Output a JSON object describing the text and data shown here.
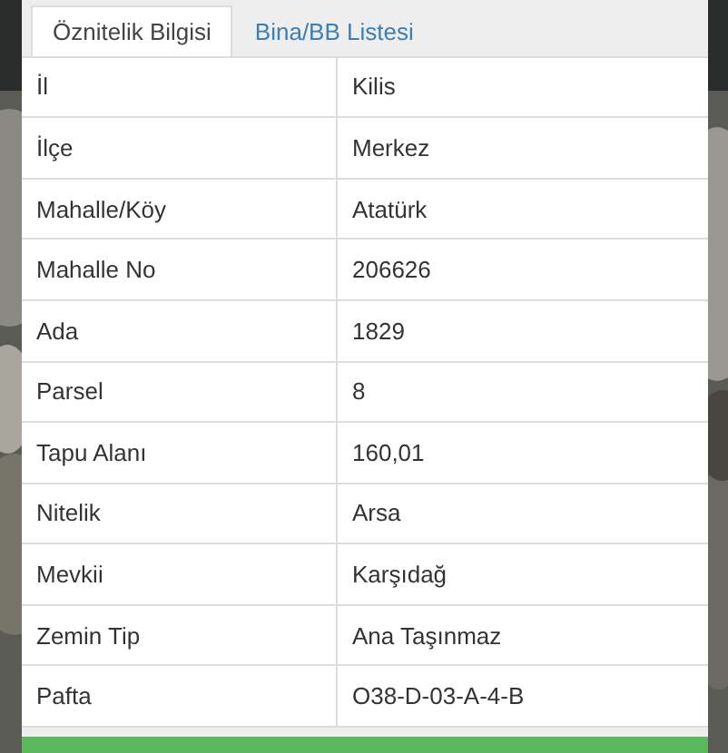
{
  "tabs": [
    {
      "label": "Öznitelik Bilgisi",
      "selected": true
    },
    {
      "label": "Bina/BB Listesi",
      "selected": false
    }
  ],
  "table": {
    "rows": [
      {
        "label": "İl",
        "value": "Kilis"
      },
      {
        "label": "İlçe",
        "value": "Merkez"
      },
      {
        "label": "Mahalle/Köy",
        "value": "Atatürk"
      },
      {
        "label": "Mahalle No",
        "value": "206626"
      },
      {
        "label": "Ada",
        "value": "1829"
      },
      {
        "label": "Parsel",
        "value": "8"
      },
      {
        "label": "Tapu Alanı",
        "value": "160,01"
      },
      {
        "label": "Nitelik",
        "value": "Arsa"
      },
      {
        "label": "Mevkii",
        "value": "Karşıdağ"
      },
      {
        "label": "Zemin Tip",
        "value": "Ana Taşınmaz"
      },
      {
        "label": "Pafta",
        "value": "O38-D-03-A-4-B"
      }
    ]
  }
}
